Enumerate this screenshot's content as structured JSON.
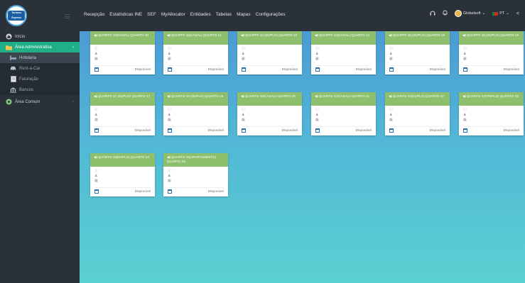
{
  "logo": {
    "line1": "Turismo",
    "line2": "Express"
  },
  "sidebar": {
    "items": [
      {
        "label": "Início",
        "icon": "home-icon"
      },
      {
        "label": "Área Administrativa",
        "icon": "folder-icon",
        "active": true
      },
      {
        "label": "Hotelaria",
        "icon": "bed-icon",
        "sub": true,
        "selected": true
      },
      {
        "label": "Rent-a-Car",
        "icon": "car-icon",
        "sub": true
      },
      {
        "label": "Faturação",
        "icon": "invoice-icon",
        "sub": true
      },
      {
        "label": "Bancos",
        "icon": "bank-icon",
        "sub": true
      },
      {
        "label": "Área Comum",
        "icon": "gear-icon"
      }
    ]
  },
  "topbar": {
    "menu": [
      "Recepção",
      "Estatísticas INE",
      "SEF",
      "MyAllocator",
      "Entidades",
      "Tabelas",
      "Mapas",
      "Configurações"
    ],
    "user": "Globalsoft",
    "lang": "PT"
  },
  "status_label": "Disponível",
  "rooms": [
    {
      "title": "QUARTO 10(CASAL) QUARTO 10"
    },
    {
      "title": "QUARTO 11(CASAL) QUARTO 11"
    },
    {
      "title": "QUARTO 12 (DUPLO) QUARTO 12"
    },
    {
      "title": "QUARTO 14(CASAL) QUARTO 14"
    },
    {
      "title": "QUARTO 15 (DUPLO) QUARTO 15"
    },
    {
      "title": "QUARTO 16 (DUPLO) QUARTO 16"
    },
    {
      "title": "QUARTO 17 (DUPLO) QUARTO 17"
    },
    {
      "title": "QUARTO 18 (DUPLO) QUARTO 18"
    },
    {
      "title": "QUARTO 20(CASAL) QUARTO 20"
    },
    {
      "title": "QUARTO 21(CASAL) QUARTO 21"
    },
    {
      "title": "QUARTO 22(DUPLO) QUARTO 22"
    },
    {
      "title": "QUARTO 23(TRIPLO) QUARTO 23"
    },
    {
      "title": "QUARTO 24(DUPLO) QUARTO 24"
    },
    {
      "title": "QUARTO 25(APARTAMENTO) QUARTO 25"
    }
  ]
}
